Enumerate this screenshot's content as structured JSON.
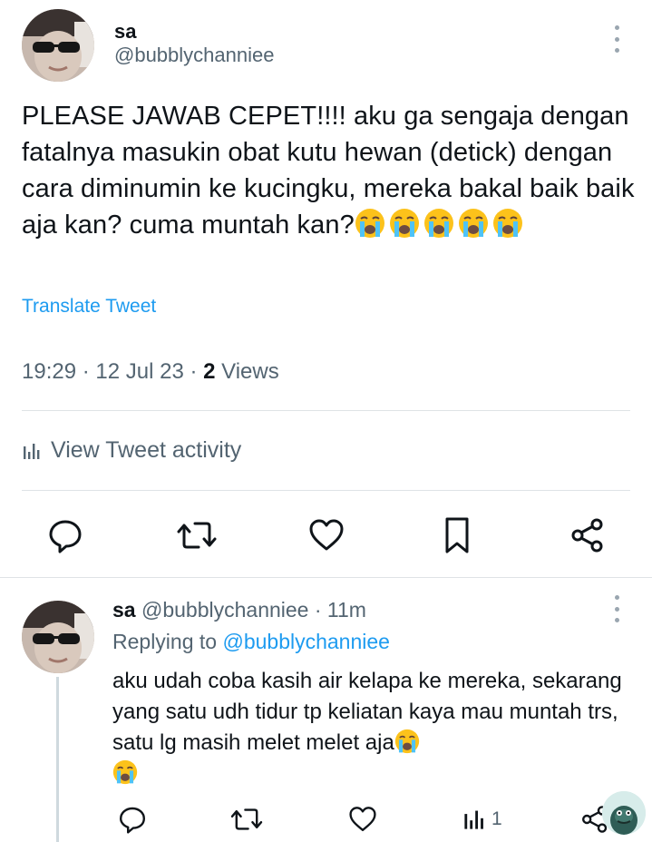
{
  "tweet": {
    "display_name": "sa",
    "handle": "@bubblychanniee",
    "text": "PLEASE JAWAB CEPET!!!! aku ga sengaja dengan fatalnya masukin obat kutu hewan (detick) dengan cara diminumin ke kucingku, mereka bakal baik baik aja kan? cuma muntah kan?",
    "emoji": "😭😭😭😭😭",
    "translate_label": "Translate Tweet",
    "time": "19:29 · 12 Jul 23 · ",
    "views_count": "2",
    "views_label": " Views",
    "activity_label": "View Tweet activity"
  },
  "reply": {
    "display_name": "sa",
    "handle": "@bubblychanniee",
    "separator_time": " · 11m",
    "replying_prefix": "Replying to ",
    "replying_handle": "@bubblychanniee",
    "text": "aku udah coba kasih air kelapa ke mereka, sekarang yang satu udh tidur tp keliatan kaya mau muntah trs, satu lg masih melet melet aja",
    "emoji": "😭😭",
    "views_count": "1"
  },
  "icons": {
    "reply": "comment-icon",
    "retweet": "retweet-icon",
    "like": "heart-icon",
    "bookmark": "bookmark-icon",
    "share": "share-icon",
    "analytics": "analytics-icon",
    "more": "more-icon"
  },
  "colors": {
    "accent": "#1d9bf0",
    "secondary_text": "#536471",
    "primary_text": "#0f1419"
  }
}
